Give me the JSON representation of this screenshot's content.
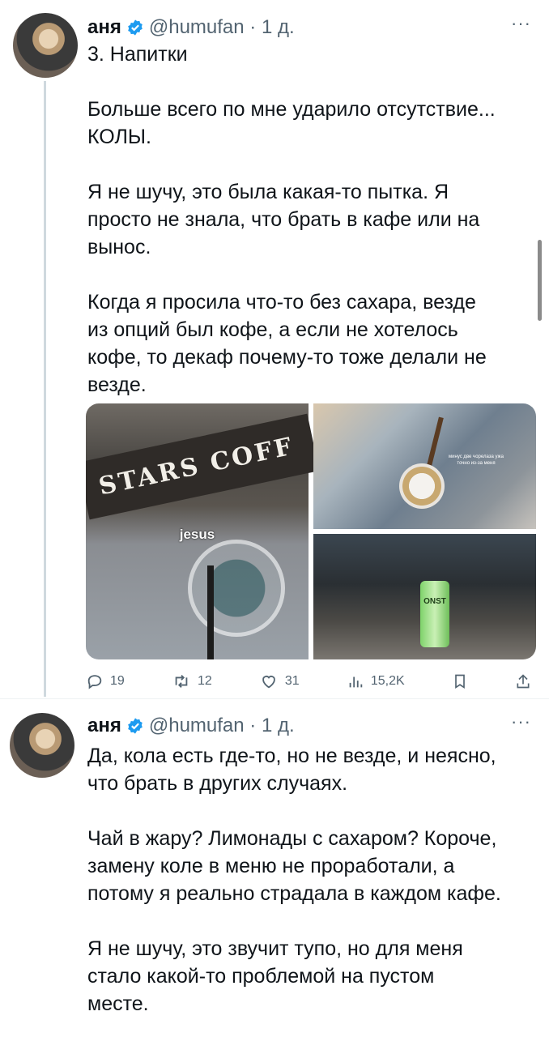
{
  "tweets": [
    {
      "author": {
        "name": "аня",
        "handle": "@humufan",
        "time": "1 д."
      },
      "paragraphs": [
        "3. Напитки",
        "Больше всего по мне ударило отсутствие...\nКОЛЫ.",
        "Я не шучу, это была какая-то пытка. Я\nпросто не знала, что брать в кафе или на\nвынос.",
        "Когда я просила что-то без сахара, везде\nиз опций был кофе, а если не хотелось\nкофе, то декаф почему-то тоже делали не\nвезде."
      ],
      "media": {
        "main_sign": "STARS COFF",
        "main_caption": "jesus",
        "top_right_caption": "минус две чорелаза ужа точно из-за меня",
        "can_label": "ONST"
      },
      "actions": {
        "replies": "19",
        "retweets": "12",
        "likes": "31",
        "views": "15,2K"
      }
    },
    {
      "author": {
        "name": "аня",
        "handle": "@humufan",
        "time": "1 д."
      },
      "paragraphs": [
        "Да, кола есть где-то, но не везде, и неясно,\nчто брать в других случаях.",
        "Чай в жару? Лимонады с сахаром? Короче,\nзамену коле в меню не проработали, а\nпотому я реально страдала в каждом кафе.",
        "Я не шучу, это звучит тупо, но для меня\nстало какой-то проблемой на пустом\nместе."
      ]
    }
  ],
  "icons": {
    "verified": "verified-badge-icon",
    "more": "more-dots-icon",
    "reply": "reply-icon",
    "retweet": "retweet-icon",
    "like": "heart-icon",
    "views": "views-bar-icon",
    "bookmark": "bookmark-icon",
    "share": "share-icon"
  },
  "colors": {
    "verified": "#1d9bf0",
    "secondary_text": "#536471",
    "thread_line": "#cfd9de"
  }
}
